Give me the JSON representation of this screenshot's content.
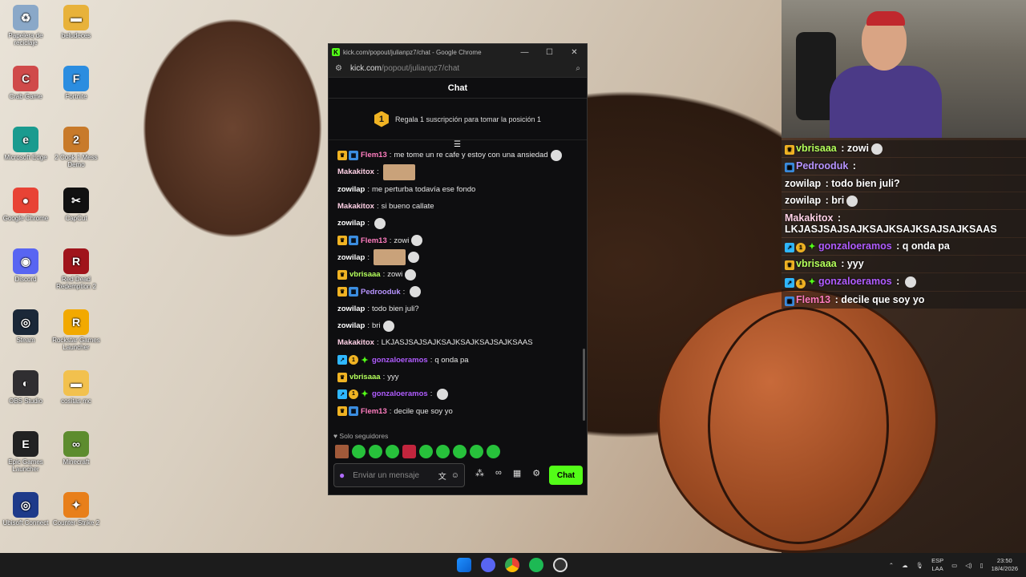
{
  "desktop_icons": [
    {
      "label": "Papelera de reciclaje",
      "icon": "recycle-bin-icon",
      "color": "#8aa8c8",
      "glyph": "♻"
    },
    {
      "label": "beludeces",
      "icon": "folder-icon",
      "color": "#e8b23a",
      "glyph": "▬"
    },
    {
      "label": "Crab Game",
      "icon": "crab-game-icon",
      "color": "#d04a4a",
      "glyph": "C"
    },
    {
      "label": "Fortnite",
      "icon": "fortnite-icon",
      "color": "#2b8de0",
      "glyph": "F"
    },
    {
      "label": "Microsoft Edge",
      "icon": "edge-icon",
      "color": "#1a9b8f",
      "glyph": "e"
    },
    {
      "label": "2 Cook 1 Mess Demo",
      "icon": "game-icon",
      "color": "#c87a2a",
      "glyph": "2"
    },
    {
      "label": "Google Chrome",
      "icon": "chrome-icon",
      "color": "#e84335",
      "glyph": "●"
    },
    {
      "label": "CapCut",
      "icon": "capcut-icon",
      "color": "#111111",
      "glyph": "✂"
    },
    {
      "label": "Discord",
      "icon": "discord-icon",
      "color": "#5865f2",
      "glyph": "◉"
    },
    {
      "label": "Red Dead Redemption 2",
      "icon": "rdr2-icon",
      "color": "#a0141b",
      "glyph": "R"
    },
    {
      "label": "Steam",
      "icon": "steam-icon",
      "color": "#1b2838",
      "glyph": "◎"
    },
    {
      "label": "Rockstar Games Launcher",
      "icon": "rockstar-icon",
      "color": "#f2a900",
      "glyph": "R"
    },
    {
      "label": "OBS Studio",
      "icon": "obs-icon",
      "color": "#302e31",
      "glyph": "◐"
    },
    {
      "label": "cositas mc",
      "icon": "folder-icon",
      "color": "#f2c14e",
      "glyph": "▬"
    },
    {
      "label": "Epic Games Launcher",
      "icon": "epic-icon",
      "color": "#222222",
      "glyph": "E"
    },
    {
      "label": "Minecraft",
      "icon": "minecraft-icon",
      "color": "#5d8c2e",
      "glyph": "∞"
    },
    {
      "label": "Ubisoft Connect",
      "icon": "ubisoft-icon",
      "color": "#1e3a8a",
      "glyph": "◎"
    },
    {
      "label": "Counter-Strike 2",
      "icon": "cs2-icon",
      "color": "#e87f1a",
      "glyph": "✦"
    }
  ],
  "window": {
    "title": "kick.com/popout/julianpz7/chat - Google Chrome",
    "url_site": "kick.com",
    "url_path": "/popout/julianpz7/chat"
  },
  "chat": {
    "header": "Chat",
    "pinned_rank": "1",
    "pinned_text": "Regala 1 suscripción para tomar la posición 1",
    "messages": [
      {
        "user": "Flem13",
        "color": "#ff7dbf",
        "badges": [
          "crown",
          "sub"
        ],
        "text": "me tome un re cafe y estoy con una ansiedad",
        "emote": true
      },
      {
        "user": "Makakitox",
        "color": "#ffd1e6",
        "badges": [],
        "text": "",
        "pic": true
      },
      {
        "user": "zowilap",
        "color": "#ffffff",
        "badges": [],
        "text": "me perturba todavía ese fondo"
      },
      {
        "user": "Makakitox",
        "color": "#ffd1e6",
        "badges": [],
        "text": "si bueno callate"
      },
      {
        "user": "zowilap",
        "color": "#ffffff",
        "badges": [],
        "text": "",
        "emote": true
      },
      {
        "user": "Flem13",
        "color": "#ff7dbf",
        "badges": [
          "crown",
          "sub"
        ],
        "text": "zowi",
        "emote": true
      },
      {
        "user": "zowilap",
        "color": "#ffffff",
        "badges": [],
        "text": "",
        "pic": true,
        "emote": true
      },
      {
        "user": "vbrisaaa",
        "color": "#b4ff5b",
        "badges": [
          "crown"
        ],
        "text": "zowi",
        "emote": true
      },
      {
        "user": "Pedrooduk",
        "color": "#b794ff",
        "badges": [
          "crown",
          "sub"
        ],
        "text": "",
        "emote": true
      },
      {
        "user": "zowilap",
        "color": "#ffffff",
        "badges": [],
        "text": "todo bien juli?"
      },
      {
        "user": "zowilap",
        "color": "#ffffff",
        "badges": [],
        "text": "bri",
        "emote": true
      },
      {
        "user": "Makakitox",
        "color": "#ffd1e6",
        "badges": [],
        "text": "LKJASJSAJSAJKSAJKSAJKSAJSAJKSAAS"
      },
      {
        "user": "gonzaloeramos",
        "color": "#b05cff",
        "badges": [
          "vip",
          "gift",
          "star"
        ],
        "text": "q onda pa"
      },
      {
        "user": "vbrisaaa",
        "color": "#b4ff5b",
        "badges": [
          "crown"
        ],
        "text": "yyy"
      },
      {
        "user": "gonzaloeramos",
        "color": "#b05cff",
        "badges": [
          "vip",
          "gift",
          "star"
        ],
        "text": "",
        "emote": true
      },
      {
        "user": "Flem13",
        "color": "#ff7dbf",
        "badges": [
          "crown",
          "sub"
        ],
        "text": "decile que soy yo"
      }
    ],
    "followers_only": "Solo seguidores",
    "input_placeholder": "Enviar un mensaje",
    "send_label": "Chat"
  },
  "overlay": [
    {
      "user": "vbrisaaa",
      "color": "#b4ff5b",
      "badges": [
        "crown"
      ],
      "text": "zowi",
      "emote": true
    },
    {
      "user": "Pedrooduk",
      "color": "#b794ff",
      "badges": [
        "sub"
      ],
      "text": ""
    },
    {
      "user": "zowilap",
      "color": "#ffffff",
      "badges": [],
      "text": "todo bien juli?"
    },
    {
      "user": "zowilap",
      "color": "#ffffff",
      "badges": [],
      "text": "bri",
      "emote": true
    },
    {
      "user": "Makakitox",
      "color": "#ffd1e6",
      "badges": [],
      "text": "LKJASJSAJSAJKSAJKSAJKSAJSAJKSAAS",
      "wrap": true
    },
    {
      "user": "gonzaloeramos",
      "color": "#b05cff",
      "badges": [
        "vip",
        "gift",
        "star"
      ],
      "text": "q onda pa"
    },
    {
      "user": "vbrisaaa",
      "color": "#b4ff5b",
      "badges": [
        "crown"
      ],
      "text": "yyy"
    },
    {
      "user": "gonzaloeramos",
      "color": "#b05cff",
      "badges": [
        "vip",
        "gift",
        "star"
      ],
      "text": "",
      "emote": true
    },
    {
      "user": "Flem13",
      "color": "#ff7dbf",
      "badges": [
        "sub"
      ],
      "text": "decile que soy yo"
    }
  ],
  "taskbar": {
    "lang_top": "ESP",
    "lang_bottom": "LAA",
    "time": "23:50",
    "date": "18/4/2026"
  }
}
